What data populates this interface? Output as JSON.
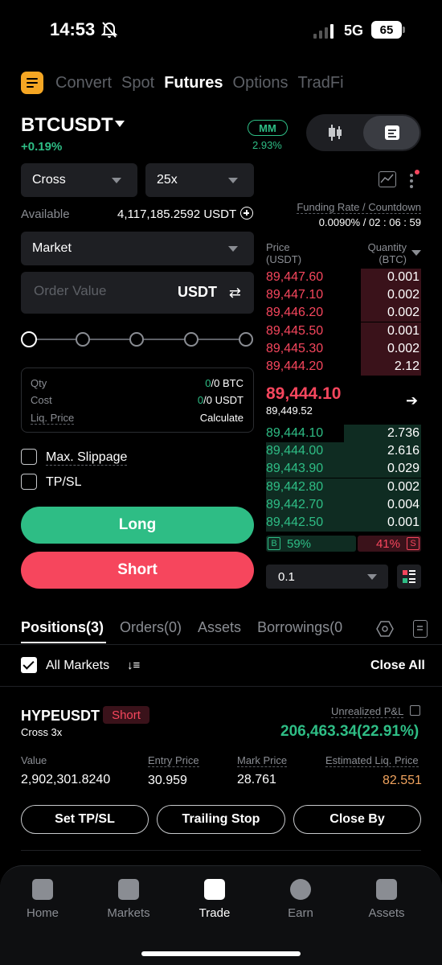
{
  "status_bar": {
    "time": "14:53",
    "network": "5G",
    "battery": "65"
  },
  "top_tabs": [
    {
      "label": "Convert",
      "active": false
    },
    {
      "label": "Spot",
      "active": false
    },
    {
      "label": "Futures",
      "active": true
    },
    {
      "label": "Options",
      "active": false
    },
    {
      "label": "TradFi",
      "active": false
    }
  ],
  "pair": {
    "symbol": "BTCUSDT",
    "change": "+0.19%",
    "mm_label": "MM",
    "mm_value": "2.93%"
  },
  "form": {
    "margin_mode": "Cross",
    "leverage": "25x",
    "available_label": "Available",
    "available_value": "4,117,185.2592 USDT",
    "order_type": "Market",
    "order_value_placeholder": "Order Value",
    "order_unit": "USDT",
    "qty_label": "Qty",
    "qty_value_a": "0",
    "qty_value_b": "/0 BTC",
    "cost_label": "Cost",
    "cost_value_a": "0",
    "cost_value_b": "/0 USDT",
    "liq_label": "Liq. Price",
    "liq_value": "Calculate",
    "max_slippage": "Max. Slippage",
    "tpsl": "TP/SL",
    "long": "Long",
    "short": "Short"
  },
  "order_book": {
    "funding_label": "Funding Rate / Countdown",
    "funding_value": "0.0090% / 02 : 06 : 59",
    "price_header_1": "Price",
    "price_header_2": "(USDT)",
    "qty_header_1": "Quantity",
    "qty_header_2": "(BTC)",
    "asks": [
      {
        "price": "89,447.60",
        "qty": "0.001",
        "depth": 0.39
      },
      {
        "price": "89,447.10",
        "qty": "0.002",
        "depth": 0.39
      },
      {
        "price": "89,446.20",
        "qty": "0.002",
        "depth": 0.39
      },
      {
        "price": "89,445.50",
        "qty": "0.001",
        "depth": 0.39
      },
      {
        "price": "89,445.30",
        "qty": "0.002",
        "depth": 0.39
      },
      {
        "price": "89,444.20",
        "qty": "2.12",
        "depth": 0.39
      }
    ],
    "last_price": "89,444.10",
    "mark_price": "89,449.52",
    "bids": [
      {
        "price": "89,444.10",
        "qty": "2.736",
        "depth": 0.5
      },
      {
        "price": "89,444.00",
        "qty": "2.616",
        "depth": 1.0
      },
      {
        "price": "89,443.90",
        "qty": "0.029",
        "depth": 1.0
      },
      {
        "price": "89,442.80",
        "qty": "0.002",
        "depth": 1.0
      },
      {
        "price": "89,442.70",
        "qty": "0.004",
        "depth": 1.0
      },
      {
        "price": "89,442.50",
        "qty": "0.001",
        "depth": 1.0
      }
    ],
    "buy_label": "B",
    "buy_ratio": "59%",
    "sell_label": "S",
    "sell_ratio": "41%",
    "depth_step": "0.1"
  },
  "positions_tabs": [
    {
      "label": "Positions(3)",
      "active": true
    },
    {
      "label": "Orders(0)",
      "active": false
    },
    {
      "label": "Assets",
      "active": false
    },
    {
      "label": "Borrowings(0",
      "active": false
    }
  ],
  "filter": {
    "all_markets": "All Markets",
    "close_all": "Close All"
  },
  "position": {
    "symbol": "HYPEUSDT",
    "side": "Short",
    "margin": "Cross 3x",
    "upnl_label": "Unrealized P&L",
    "upnl_value": "206,463.34(22.91%)",
    "value_label": "Value",
    "value": "2,902,301.8240",
    "entry_label": "Entry Price",
    "entry": "30.959",
    "mark_label": "Mark Price",
    "mark": "28.761",
    "liq_label": "Estimated Liq. Price",
    "liq": "82.551",
    "btn_tpsl": "Set TP/SL",
    "btn_trailing": "Trailing Stop",
    "btn_close": "Close By"
  },
  "bottom_nav": [
    {
      "label": "Home",
      "active": false
    },
    {
      "label": "Markets",
      "active": false
    },
    {
      "label": "Trade",
      "active": true
    },
    {
      "label": "Earn",
      "active": false
    },
    {
      "label": "Assets",
      "active": false
    }
  ],
  "colors": {
    "green": "#2ebd85",
    "red": "#f6465d",
    "accent": "#f5a623",
    "liq": "#f0a35e"
  }
}
